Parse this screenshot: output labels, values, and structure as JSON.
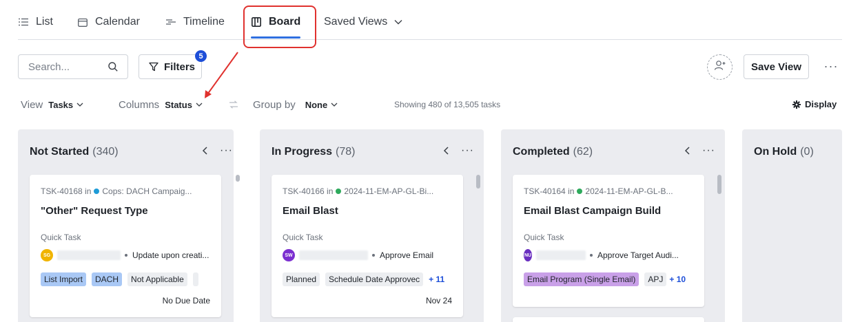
{
  "tabs": [
    {
      "label": "List",
      "icon": "list-icon"
    },
    {
      "label": "Calendar",
      "icon": "calendar-icon"
    },
    {
      "label": "Timeline",
      "icon": "timeline-icon"
    },
    {
      "label": "Board",
      "icon": "board-icon",
      "active": true
    },
    {
      "label": "Saved Views",
      "icon": "chevron-down-icon"
    }
  ],
  "toolbar": {
    "search_placeholder": "Search...",
    "filters_label": "Filters",
    "filters_count": "5",
    "save_view_label": "Save View",
    "more_label": "···"
  },
  "options": {
    "view_label": "View",
    "view_value": "Tasks",
    "columns_label": "Columns",
    "columns_value": "Status",
    "group_label": "Group by",
    "group_value": "None",
    "showing": "Showing 480 of 13,505 tasks",
    "display_label": "Display"
  },
  "colors": {
    "accent": "#2f6fe0",
    "annotation": "#e0312e",
    "badge": "#1d4ed8"
  },
  "columns": [
    {
      "name": "Not Started",
      "count": "(340)",
      "more": "···",
      "card": {
        "id_prefix": "TSK-40168 in",
        "project": "Cops: DACH Campaig...",
        "dot_color": "#1e9bd7",
        "title": "\"Other\" Request Type",
        "type": "Quick Task",
        "avatar": "SG",
        "avatar_color": "#f0b400",
        "step": "Update upon creati...",
        "tags": [
          "List Import",
          "DACH",
          "Not Applicable"
        ],
        "due": "No Due Date"
      }
    },
    {
      "name": "In Progress",
      "count": "(78)",
      "more": "···",
      "card": {
        "id_prefix": "TSK-40166 in",
        "project": "2024-11-EM-AP-GL-Bi...",
        "dot_color": "#2eaa5c",
        "title": "Email Blast",
        "type": "Quick Task",
        "avatar": "SW",
        "avatar_color": "#7b2fd0",
        "step": "Approve Email",
        "tags": [
          "Planned",
          "Schedule Date Approvec"
        ],
        "plus": "+ 11",
        "due": "Nov 24"
      }
    },
    {
      "name": "Completed",
      "count": "(62)",
      "more": "···",
      "card": {
        "id_prefix": "TSK-40164 in",
        "project": "2024-11-EM-AP-GL-B...",
        "dot_color": "#2eaa5c",
        "title": "Email Blast Campaign Build",
        "type": "Quick Task",
        "avatar": "NU",
        "avatar_color": "#6a2fc0",
        "step": "Approve Target Audi...",
        "tags": [
          "Email Program (Single Email)",
          "APJ"
        ],
        "plus": "+ 10"
      }
    },
    {
      "name": "On Hold",
      "count": "(0)"
    }
  ]
}
